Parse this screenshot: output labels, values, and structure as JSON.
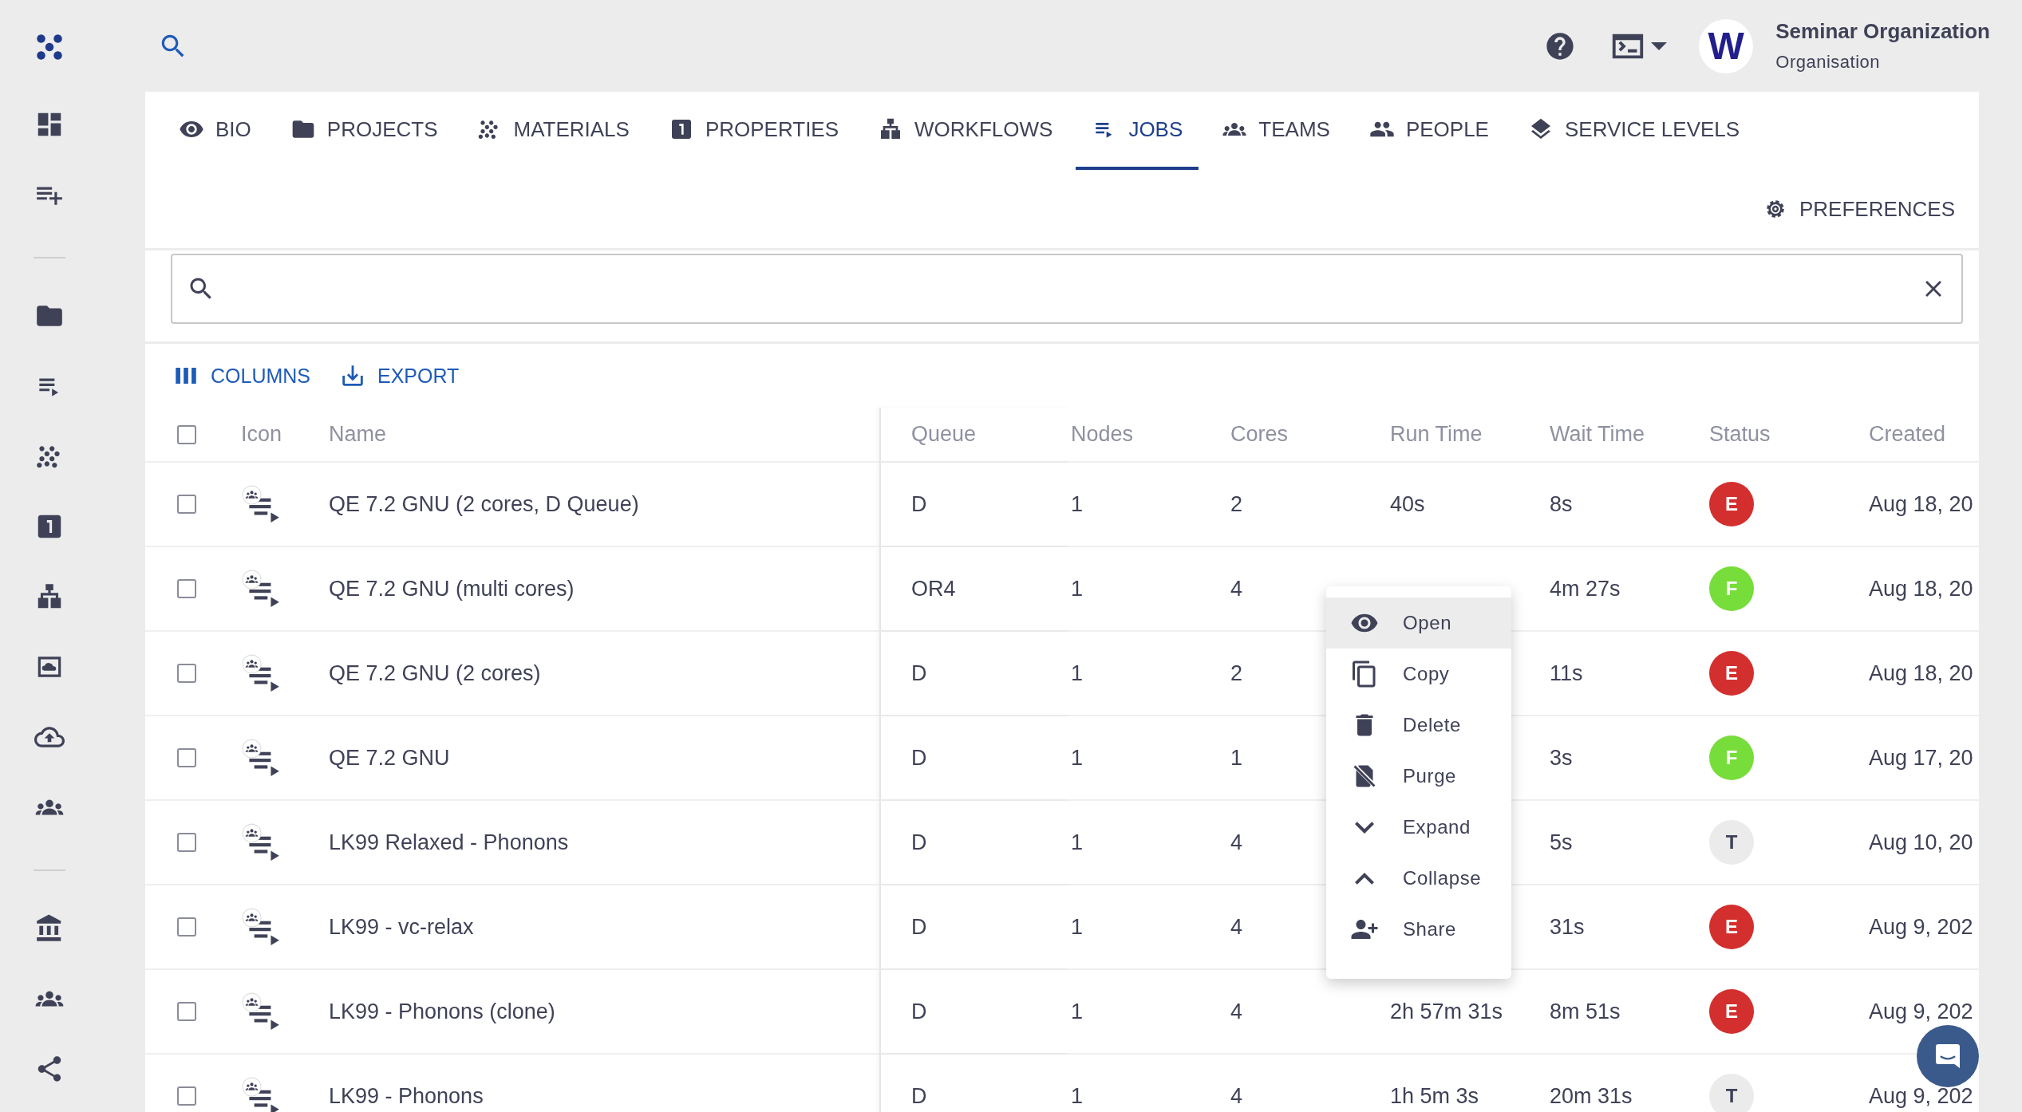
{
  "header": {
    "avatar_letter": "W",
    "org_name": "Seminar Organization",
    "org_type": "Organisation"
  },
  "tabs": [
    {
      "label": "BIO",
      "selected": false
    },
    {
      "label": "PROJECTS",
      "selected": false
    },
    {
      "label": "MATERIALS",
      "selected": false
    },
    {
      "label": "PROPERTIES",
      "selected": false
    },
    {
      "label": "WORKFLOWS",
      "selected": false
    },
    {
      "label": "JOBS",
      "selected": true
    },
    {
      "label": "TEAMS",
      "selected": false
    },
    {
      "label": "PEOPLE",
      "selected": false
    },
    {
      "label": "SERVICE LEVELS",
      "selected": false
    }
  ],
  "preferences_label": "PREFERENCES",
  "toolbar": [
    "COLUMNS",
    "EXPORT"
  ],
  "table": {
    "select_all_checked": false,
    "columns": [
      "Icon",
      "Name",
      "Queue",
      "Nodes",
      "Cores",
      "Run Time",
      "Wait Time",
      "Status",
      "Created"
    ],
    "rows": [
      {
        "checked": false,
        "name": "QE 7.2 GNU (2 cores, D Queue)",
        "queue": "D",
        "nodes": "1",
        "cores": "2",
        "run_time": "40s",
        "wait_time": "8s",
        "status": {
          "letter": "E",
          "color": "#d32f2f"
        },
        "created": "Aug 18, 20"
      },
      {
        "checked": false,
        "name": "QE 7.2 GNU (multi cores)",
        "queue": "OR4",
        "nodes": "1",
        "cores": "4",
        "wait_time": "4m 27s",
        "status": {
          "letter": "F",
          "color": "#76dd3a"
        },
        "created": "Aug 18, 20"
      },
      {
        "checked": false,
        "name": "QE 7.2 GNU (2 cores)",
        "queue": "D",
        "nodes": "1",
        "cores": "2",
        "wait_time": "11s",
        "status": {
          "letter": "E",
          "color": "#d32f2f"
        },
        "created": "Aug 18, 20"
      },
      {
        "checked": false,
        "name": "QE 7.2 GNU",
        "queue": "D",
        "nodes": "1",
        "cores": "1",
        "wait_time": "3s",
        "status": {
          "letter": "F",
          "color": "#76dd3a"
        },
        "created": "Aug 17, 20"
      },
      {
        "checked": false,
        "name": "LK99 Relaxed - Phonons",
        "queue": "D",
        "nodes": "1",
        "cores": "4",
        "wait_time": "5s",
        "status": {
          "letter": "T",
          "color": "#ebebeb"
        },
        "created": "Aug 10, 20"
      },
      {
        "checked": false,
        "name": "LK99 - vc-relax",
        "queue": "D",
        "nodes": "1",
        "cores": "4",
        "wait_time": "31s",
        "status": {
          "letter": "E",
          "color": "#d32f2f"
        },
        "created": "Aug 9, 202"
      },
      {
        "checked": false,
        "name": "LK99 - Phonons (clone)",
        "queue": "D",
        "nodes": "1",
        "cores": "4",
        "run_time": "2h 57m 31s",
        "wait_time": "8m 51s",
        "status": {
          "letter": "E",
          "color": "#d32f2f"
        },
        "created": "Aug 9, 202"
      },
      {
        "checked": false,
        "name": "LK99 - Phonons",
        "queue": "D",
        "nodes": "1",
        "cores": "4",
        "run_time": "1h 5m 3s",
        "wait_time": "20m 31s",
        "status": {
          "letter": "T",
          "color": "#ebebeb"
        },
        "created": "Aug 9, 202"
      }
    ]
  },
  "context_menu": {
    "items": [
      {
        "label": "Open",
        "selected": true
      },
      {
        "label": "Copy",
        "selected": false
      },
      {
        "label": "Delete",
        "selected": false
      },
      {
        "label": "Purge",
        "selected": false
      },
      {
        "label": "Expand",
        "selected": false
      },
      {
        "label": "Collapse",
        "selected": false
      },
      {
        "label": "Share",
        "selected": false
      }
    ]
  }
}
